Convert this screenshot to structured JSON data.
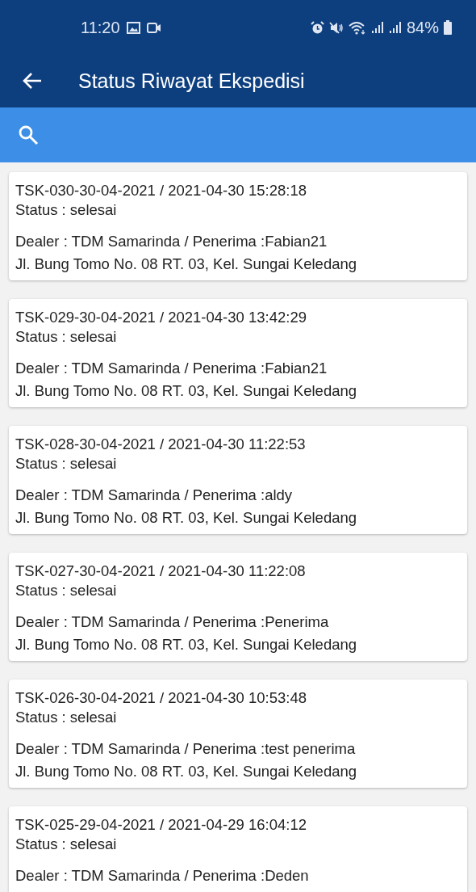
{
  "status_bar": {
    "time": "11:20",
    "battery": "84%"
  },
  "app_bar": {
    "title": "Status Riwayat Ekspedisi"
  },
  "records": [
    {
      "title": "TSK-030-30-04-2021 / 2021-04-30 15:28:18",
      "status": "Status : selesai",
      "dealer": "Dealer : TDM Samarinda / Penerima :Fabian21",
      "address": "Jl. Bung Tomo No. 08 RT. 03, Kel. Sungai Keledang"
    },
    {
      "title": "TSK-029-30-04-2021 / 2021-04-30 13:42:29",
      "status": "Status : selesai",
      "dealer": "Dealer : TDM Samarinda / Penerima :Fabian21",
      "address": "Jl. Bung Tomo No. 08 RT. 03, Kel. Sungai Keledang"
    },
    {
      "title": "TSK-028-30-04-2021 / 2021-04-30 11:22:53",
      "status": "Status : selesai",
      "dealer": "Dealer : TDM Samarinda / Penerima :aldy",
      "address": "Jl. Bung Tomo No. 08 RT. 03, Kel. Sungai Keledang"
    },
    {
      "title": "TSK-027-30-04-2021 / 2021-04-30 11:22:08",
      "status": "Status : selesai",
      "dealer": "Dealer : TDM Samarinda / Penerima :Penerima",
      "address": "Jl. Bung Tomo No. 08 RT. 03, Kel. Sungai Keledang"
    },
    {
      "title": "TSK-026-30-04-2021 / 2021-04-30 10:53:48",
      "status": "Status : selesai",
      "dealer": "Dealer : TDM Samarinda / Penerima :test penerima",
      "address": "Jl. Bung Tomo No. 08 RT. 03, Kel. Sungai Keledang"
    },
    {
      "title": "TSK-025-29-04-2021 / 2021-04-29 16:04:12",
      "status": "Status : selesai",
      "dealer": "Dealer : TDM Samarinda / Penerima :Deden"
    }
  ]
}
